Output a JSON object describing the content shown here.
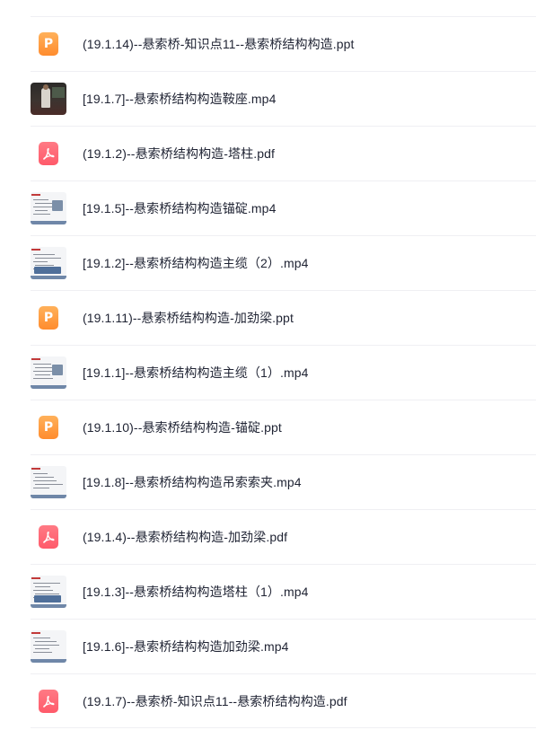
{
  "files": [
    {
      "name": "(19.1.14)--悬索桥-知识点11--悬索桥结构构造.ppt",
      "icon": "ppt-icon"
    },
    {
      "name": "[19.1.7]--悬索桥结构构造鞍座.mp4",
      "icon": "video-thumbnail-photo"
    },
    {
      "name": "(19.1.2)--悬索桥结构构造-塔柱.pdf",
      "icon": "pdf-icon"
    },
    {
      "name": "[19.1.5]--悬索桥结构构造锚碇.mp4",
      "icon": "video-thumbnail-slide"
    },
    {
      "name": "[19.1.2]--悬索桥结构构造主缆（2）.mp4",
      "icon": "video-thumbnail-slide"
    },
    {
      "name": "(19.1.11)--悬索桥结构构造-加劲梁.ppt",
      "icon": "ppt-icon"
    },
    {
      "name": "[19.1.1]--悬索桥结构构造主缆（1）.mp4",
      "icon": "video-thumbnail-slide"
    },
    {
      "name": "(19.1.10)--悬索桥结构构造-锚碇.ppt",
      "icon": "ppt-icon"
    },
    {
      "name": "[19.1.8]--悬索桥结构构造吊索索夹.mp4",
      "icon": "video-thumbnail-slide"
    },
    {
      "name": "(19.1.4)--悬索桥结构构造-加劲梁.pdf",
      "icon": "pdf-icon"
    },
    {
      "name": "[19.1.3]--悬索桥结构构造塔柱（1）.mp4",
      "icon": "video-thumbnail-slide"
    },
    {
      "name": "[19.1.6]--悬索桥结构构造加劲梁.mp4",
      "icon": "video-thumbnail-slide"
    },
    {
      "name": "(19.1.7)--悬索桥-知识点11--悬索桥结构构造.pdf",
      "icon": "pdf-icon"
    }
  ],
  "colors": {
    "ppt": "#ff9a3c",
    "pdf": "#ff6474",
    "text": "#1f2333",
    "divider": "#efeff3"
  }
}
